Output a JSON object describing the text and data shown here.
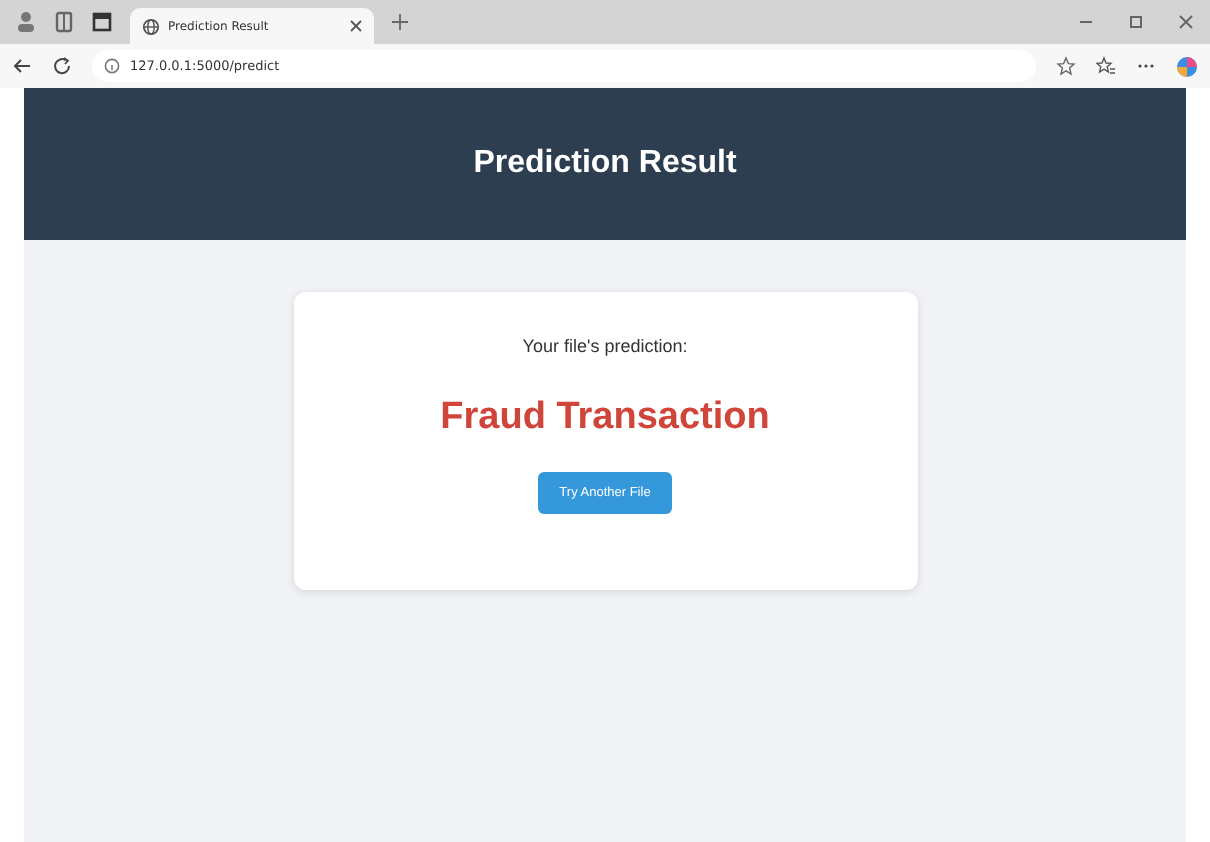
{
  "browser": {
    "tab_title": "Prediction Result",
    "address": "127.0.0.1:5000/predict"
  },
  "header": {
    "title": "Prediction Result"
  },
  "card": {
    "label": "Your file's prediction:",
    "result": {
      "text": "Fraud Transaction",
      "kind": "fraud"
    },
    "button": "Try Another File"
  }
}
